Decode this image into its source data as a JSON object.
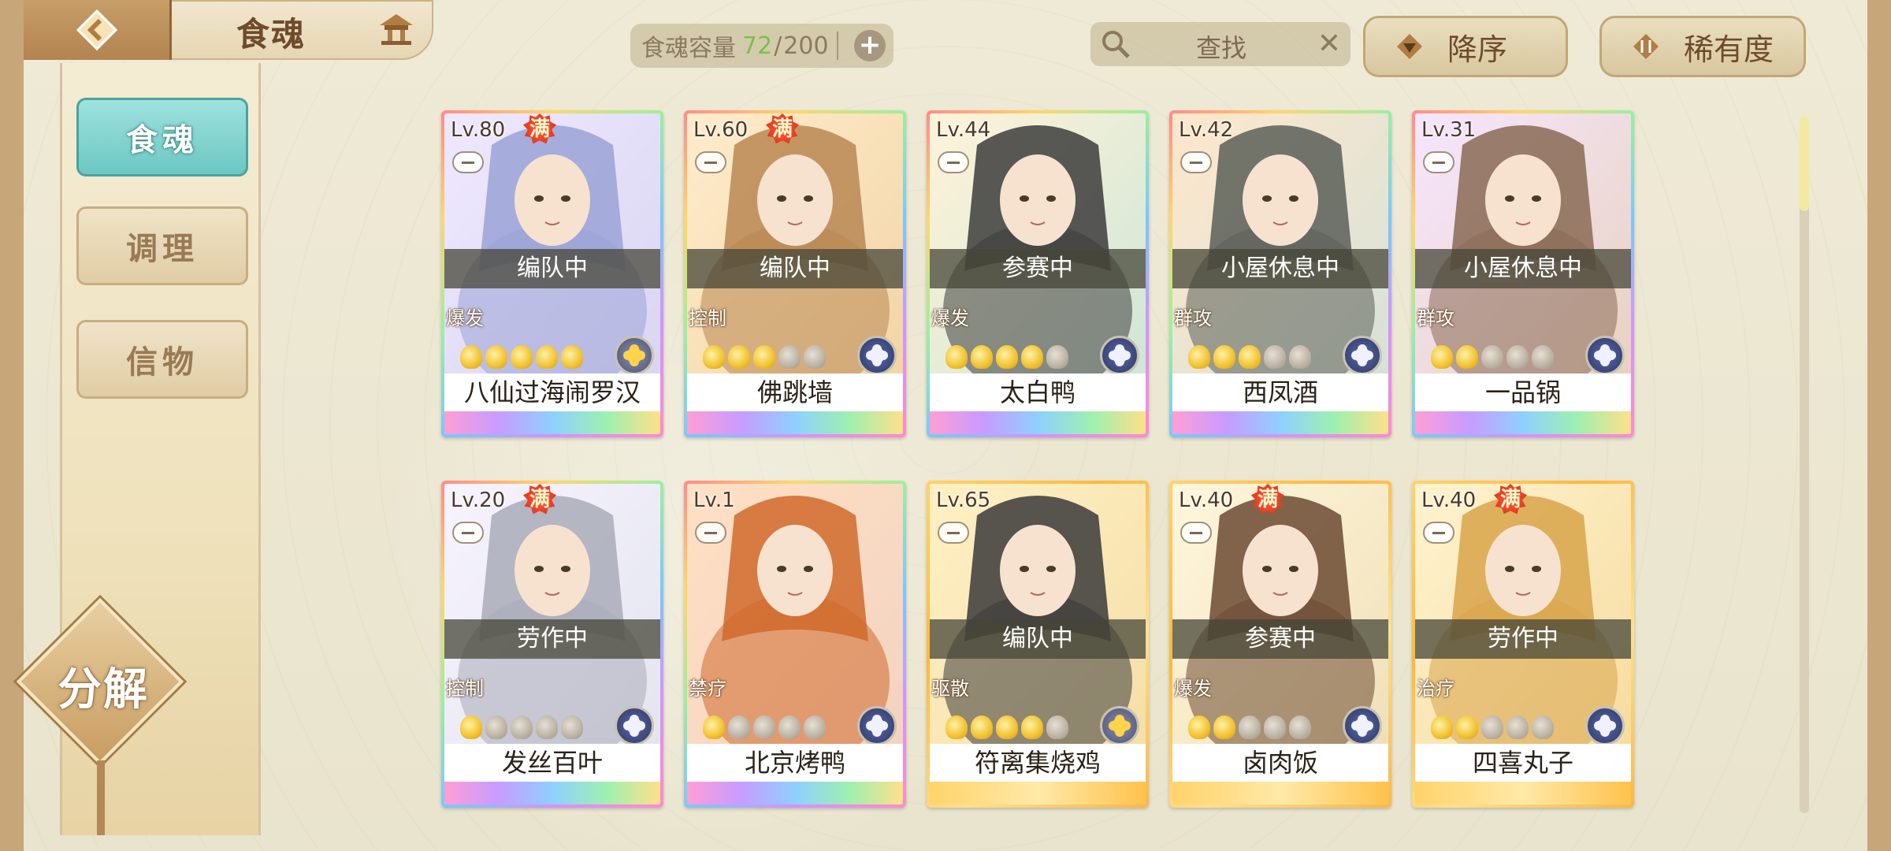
{
  "header": {
    "title": "食魂",
    "capacity_label": "食魂容量",
    "capacity_current": "72",
    "capacity_sep": "/",
    "capacity_max": "200",
    "search_placeholder": "查找",
    "sort_label": "降序",
    "rarity_label": "稀有度"
  },
  "sidebar": {
    "items": [
      {
        "label": "食魂",
        "active": true
      },
      {
        "label": "调理",
        "active": false
      },
      {
        "label": "信物",
        "active": false
      }
    ],
    "decompose_label": "分解"
  },
  "cards": [
    {
      "level": "Lv.80",
      "full": "满",
      "status": "编队中",
      "role": "爆发",
      "stars": 5,
      "name": "八仙过海闹罗汉",
      "frame": "rainbow",
      "element": "gold"
    },
    {
      "level": "Lv.60",
      "full": "满",
      "status": "编队中",
      "role": "控制",
      "stars": 3,
      "name": "佛跳墙",
      "frame": "rainbow",
      "element": "blue"
    },
    {
      "level": "Lv.44",
      "full": "",
      "status": "参赛中",
      "role": "爆发",
      "stars": 4,
      "name": "太白鸭",
      "frame": "rainbow",
      "element": "blue"
    },
    {
      "level": "Lv.42",
      "full": "",
      "status": "小屋休息中",
      "role": "群攻",
      "stars": 3,
      "name": "西凤酒",
      "frame": "rainbow",
      "element": "blue"
    },
    {
      "level": "Lv.31",
      "full": "",
      "status": "小屋休息中",
      "role": "群攻",
      "stars": 2,
      "name": "一品锅",
      "frame": "rainbow",
      "element": "blue"
    },
    {
      "level": "Lv.20",
      "full": "满",
      "status": "劳作中",
      "role": "控制",
      "stars": 1,
      "name": "发丝百叶",
      "frame": "rainbow",
      "element": "blue"
    },
    {
      "level": "Lv.1",
      "full": "",
      "status": "",
      "role": "禁疗",
      "stars": 1,
      "name": "北京烤鸭",
      "frame": "rainbow",
      "element": "blue"
    },
    {
      "level": "Lv.65",
      "full": "",
      "status": "编队中",
      "role": "驱散",
      "stars": 4,
      "name": "符离集烧鸡",
      "frame": "gold",
      "element": "gold"
    },
    {
      "level": "Lv.40",
      "full": "满",
      "status": "参赛中",
      "role": "爆发",
      "stars": 2,
      "name": "卤肉饭",
      "frame": "gold",
      "element": "blue"
    },
    {
      "level": "Lv.40",
      "full": "满",
      "status": "劳作中",
      "role": "治疗",
      "stars": 2,
      "name": "四喜丸子",
      "frame": "gold",
      "element": "blue"
    }
  ],
  "colors": {
    "accent_teal": "#6cc7c2",
    "capacity_green": "#7bc14a",
    "full_badge_red": "#e2391f"
  }
}
